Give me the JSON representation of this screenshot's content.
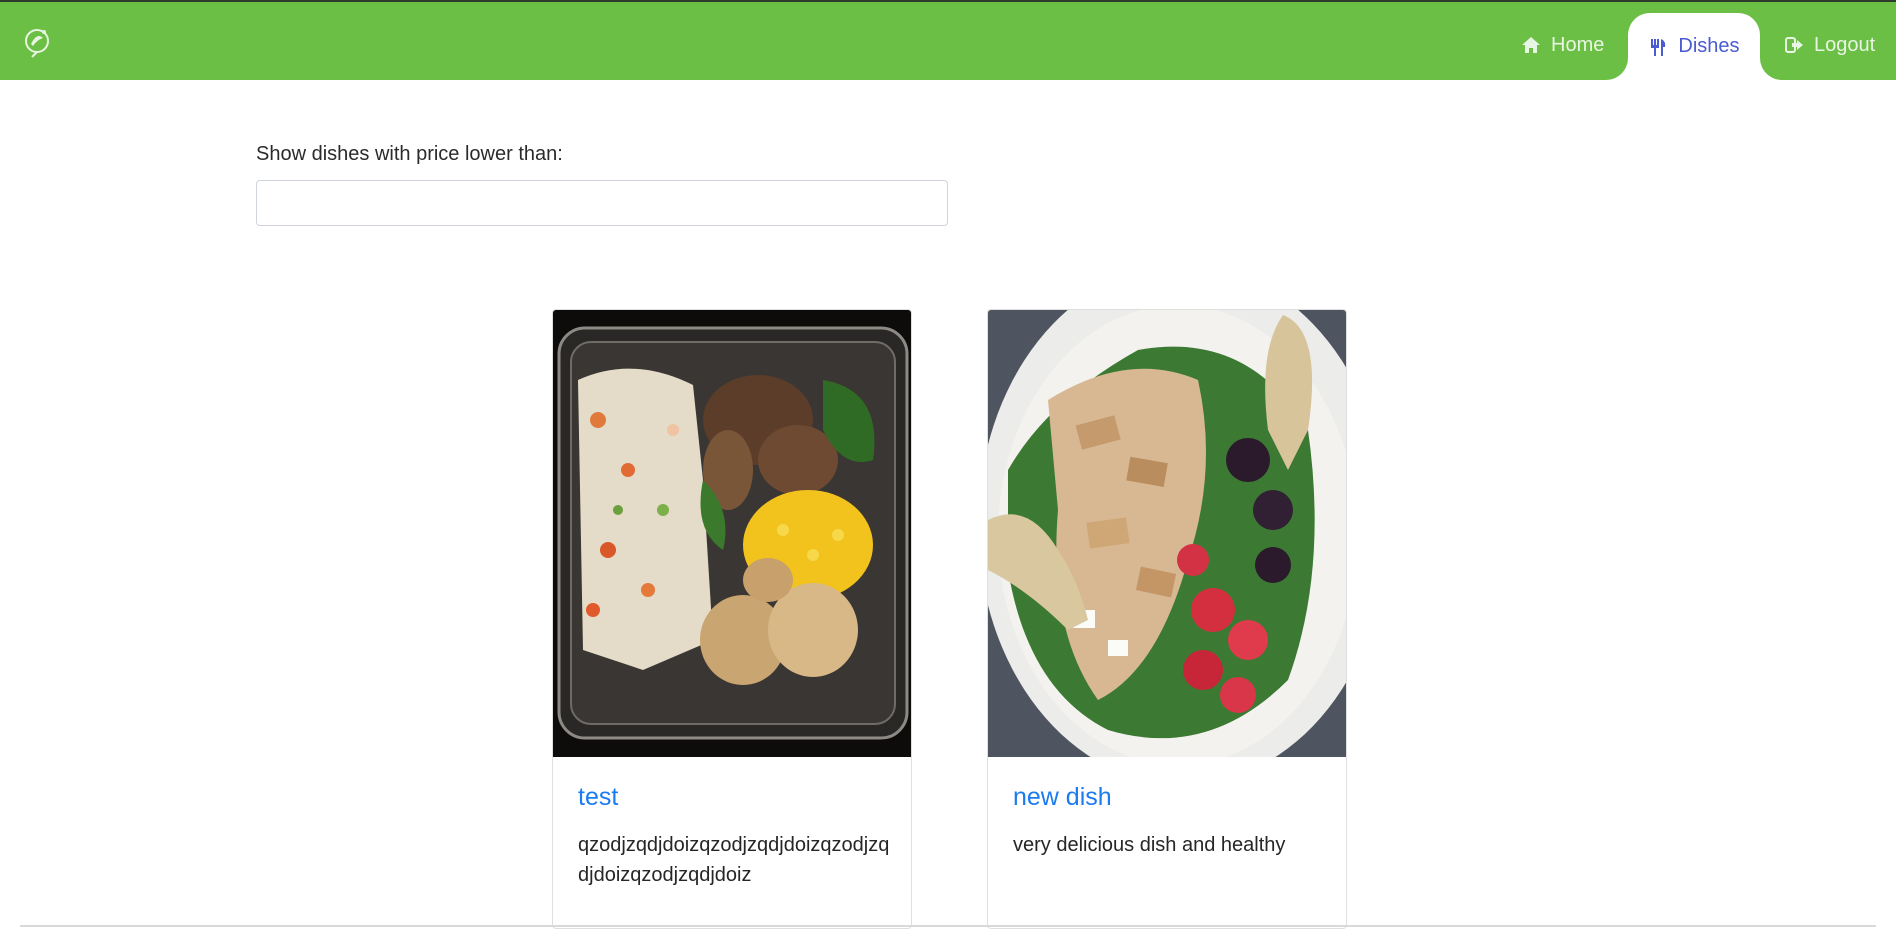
{
  "navbar": {
    "logo_icon": "leaf-logo-icon",
    "brand_color": "#6abf44",
    "items": [
      {
        "label": "Home",
        "icon": "home-icon"
      },
      {
        "label": "Dishes",
        "icon": "utensils-icon",
        "active": true
      },
      {
        "label": "Logout",
        "icon": "logout-icon"
      }
    ]
  },
  "filter": {
    "label": "Show dishes with price lower than:",
    "value": "",
    "placeholder": ""
  },
  "dishes": [
    {
      "title": "test",
      "description": "qzodjzqdjdoizqzodjzqdjdoizqzodjzqdjdoizqzodjzqdjdoiz"
    },
    {
      "title": "new dish",
      "description": "very delicious dish and healthy"
    }
  ],
  "colors": {
    "link": "#1b7cf0",
    "active_tab_text": "#4b5bd0"
  }
}
